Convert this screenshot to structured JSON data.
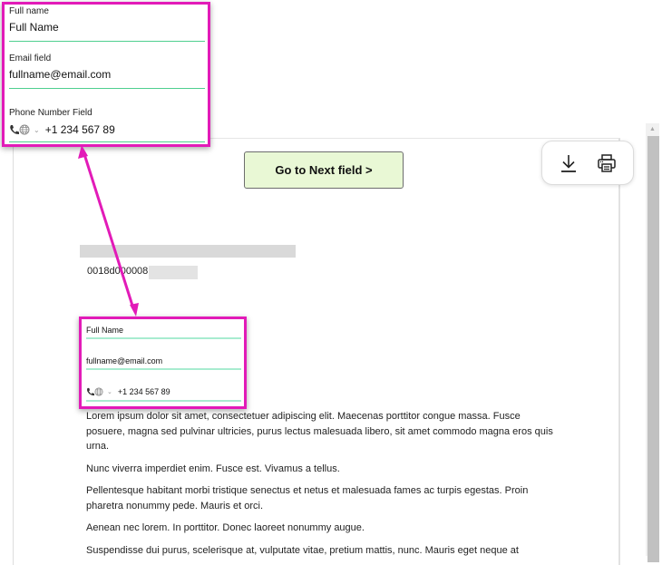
{
  "form_panel_large": {
    "full_name": {
      "label": "Full name",
      "value": "Full Name"
    },
    "email": {
      "label": "Email field",
      "value": "fullname@email.com"
    },
    "phone": {
      "label": "Phone Number Field",
      "value": "+1 234 567 89",
      "icons": [
        "phone-icon",
        "globe-icon",
        "chevron-down-icon"
      ]
    }
  },
  "toolbar": {
    "download_icon": "download-icon",
    "print_icon": "print-icon"
  },
  "next_button": {
    "label": "Go to Next field >"
  },
  "document": {
    "record_id": "0018d000008",
    "embedded_form": {
      "full_name": "Full Name",
      "email": "fullname@email.com",
      "phone": "+1 234 567 89"
    },
    "paragraphs": [
      "Lorem ipsum dolor sit amet, consectetuer adipiscing elit. Maecenas porttitor congue massa. Fusce posuere, magna sed pulvinar ultricies, purus lectus malesuada libero, sit amet commodo magna eros quis urna.",
      "Nunc viverra imperdiet enim. Fusce est. Vivamus a tellus.",
      "Pellentesque habitant morbi tristique senectus et netus et malesuada fames ac turpis egestas. Proin pharetra nonummy pede. Mauris et orci.",
      "Aenean nec lorem. In porttitor. Donec laoreet nonummy augue.",
      "Suspendisse dui purus, scelerisque at, vulputate vitae, pretium mattis, nunc. Mauris eget neque at"
    ]
  },
  "colors": {
    "highlight": "#e21bb8",
    "field_underline": "#4fcf8f",
    "button_bg": "#e9f8d5"
  }
}
